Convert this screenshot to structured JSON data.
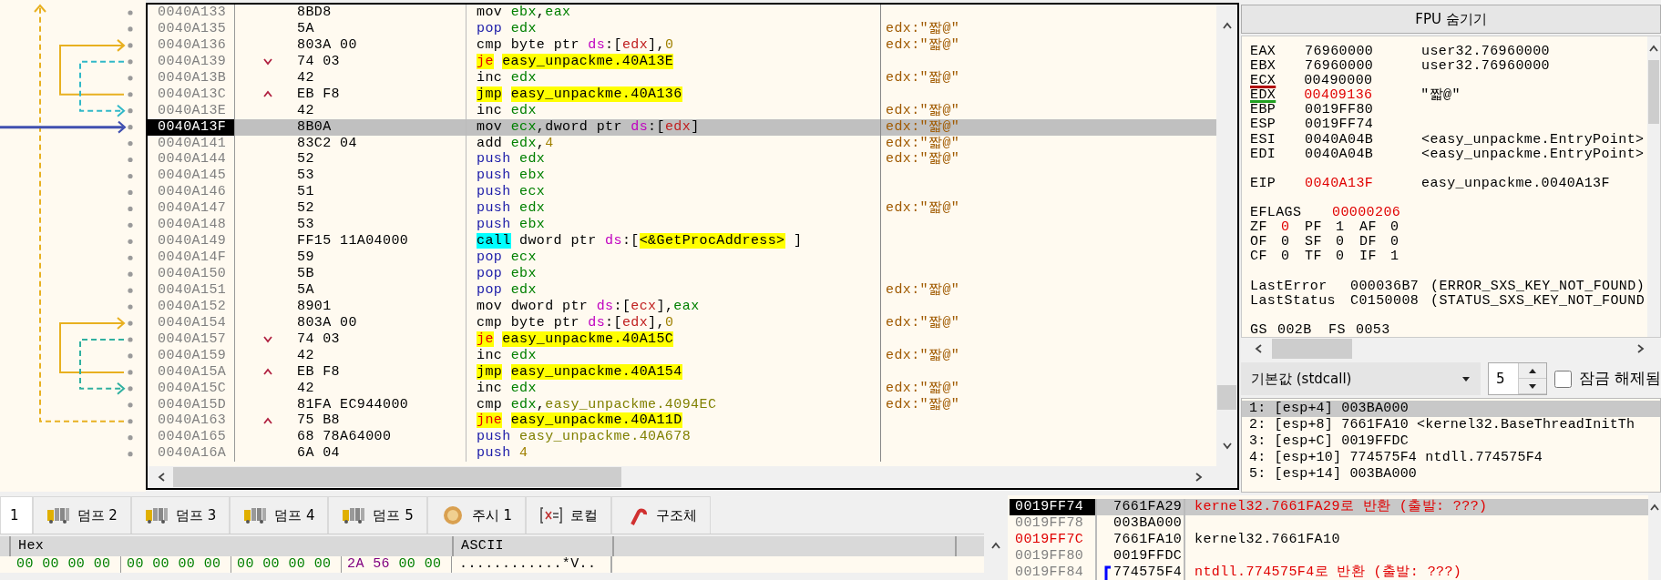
{
  "disassembly": {
    "rows": [
      {
        "address": "0040A133",
        "bytes": "8BD8",
        "instruction": [
          [
            {
              "kind": "op",
              "text": "mov"
            }
          ],
          [
            {
              "kind": "reg",
              "text": "ebx"
            },
            {
              "kind": "plain",
              "text": ","
            },
            {
              "kind": "reg",
              "text": "eax"
            }
          ]
        ],
        "selected": false,
        "current": false
      },
      {
        "address": "0040A135",
        "bytes": "5A",
        "instruction": [
          [
            {
              "kind": "stack",
              "text": "pop"
            }
          ],
          [
            {
              "kind": "reg",
              "text": "edx"
            }
          ]
        ],
        "comment": "edx:\"짧@\"",
        "selected": false,
        "current": false
      },
      {
        "address": "0040A136",
        "bytes": "803A 00",
        "instruction": [
          [
            {
              "kind": "op",
              "text": "cmp"
            }
          ],
          [
            {
              "kind": "plain",
              "text": "byte"
            }
          ],
          [
            {
              "kind": "plain",
              "text": "ptr"
            }
          ],
          [
            {
              "kind": "seg",
              "text": "ds"
            },
            {
              "kind": "plain",
              "text": ":["
            },
            {
              "kind": "memreg",
              "text": "edx"
            },
            {
              "kind": "plain",
              "text": "],"
            },
            {
              "kind": "num",
              "text": "0"
            }
          ]
        ],
        "comment": "edx:\"짧@\"",
        "selected": false,
        "current": false
      },
      {
        "address": "0040A139",
        "kind": "jump-down",
        "bytes": "74 03",
        "instruction": [
          [
            {
              "kind": "jcc",
              "text": "je"
            }
          ],
          [
            {
              "kind": "target",
              "text": "easy_unpackme.40A13E"
            }
          ]
        ],
        "selected": false,
        "current": false
      },
      {
        "address": "0040A13B",
        "bytes": "42",
        "instruction": [
          [
            {
              "kind": "op",
              "text": "inc"
            }
          ],
          [
            {
              "kind": "reg",
              "text": "edx"
            }
          ]
        ],
        "comment": "edx:\"짧@\"",
        "selected": false,
        "current": false
      },
      {
        "address": "0040A13C",
        "kind": "jump-up",
        "bytes": "EB F8",
        "instruction": [
          [
            {
              "kind": "jmp",
              "text": "jmp"
            }
          ],
          [
            {
              "kind": "target",
              "text": "easy_unpackme.40A136"
            }
          ]
        ],
        "selected": false,
        "current": false
      },
      {
        "address": "0040A13E",
        "bytes": "42",
        "instruction": [
          [
            {
              "kind": "op",
              "text": "inc"
            }
          ],
          [
            {
              "kind": "reg",
              "text": "edx"
            }
          ]
        ],
        "comment": "edx:\"짧@\"",
        "selected": false,
        "current": false
      },
      {
        "address": "0040A13F",
        "bytes": "8B0A",
        "instruction": [
          [
            {
              "kind": "op",
              "text": "mov"
            }
          ],
          [
            {
              "kind": "reg",
              "text": "ecx"
            },
            {
              "kind": "plain",
              "text": ",dword"
            }
          ],
          [
            {
              "kind": "plain",
              "text": "ptr"
            }
          ],
          [
            {
              "kind": "seg",
              "text": "ds"
            },
            {
              "kind": "plain",
              "text": ":["
            },
            {
              "kind": "memreg",
              "text": "edx"
            },
            {
              "kind": "plain",
              "text": "]"
            }
          ]
        ],
        "comment": "edx:\"짧@\"",
        "selected": true,
        "current": true
      },
      {
        "address": "0040A141",
        "bytes": "83C2 04",
        "instruction": [
          [
            {
              "kind": "op",
              "text": "add"
            }
          ],
          [
            {
              "kind": "reg",
              "text": "edx"
            },
            {
              "kind": "plain",
              "text": ","
            },
            {
              "kind": "num",
              "text": "4"
            }
          ]
        ],
        "comment": "edx:\"짧@\"",
        "selected": false,
        "current": false
      },
      {
        "address": "0040A144",
        "bytes": "52",
        "instruction": [
          [
            {
              "kind": "stack",
              "text": "push"
            }
          ],
          [
            {
              "kind": "reg",
              "text": "edx"
            }
          ]
        ],
        "comment": "edx:\"짧@\"",
        "selected": false,
        "current": false
      },
      {
        "address": "0040A145",
        "bytes": "53",
        "instruction": [
          [
            {
              "kind": "stack",
              "text": "push"
            }
          ],
          [
            {
              "kind": "reg",
              "text": "ebx"
            }
          ]
        ],
        "selected": false,
        "current": false
      },
      {
        "address": "0040A146",
        "bytes": "51",
        "instruction": [
          [
            {
              "kind": "stack",
              "text": "push"
            }
          ],
          [
            {
              "kind": "reg",
              "text": "ecx"
            }
          ]
        ],
        "selected": false,
        "current": false
      },
      {
        "address": "0040A147",
        "bytes": "52",
        "instruction": [
          [
            {
              "kind": "stack",
              "text": "push"
            }
          ],
          [
            {
              "kind": "reg",
              "text": "edx"
            }
          ]
        ],
        "comment": "edx:\"짧@\"",
        "selected": false,
        "current": false
      },
      {
        "address": "0040A148",
        "bytes": "53",
        "instruction": [
          [
            {
              "kind": "stack",
              "text": "push"
            }
          ],
          [
            {
              "kind": "reg",
              "text": "ebx"
            }
          ]
        ],
        "selected": false,
        "current": false
      },
      {
        "address": "0040A149",
        "bytes": "FF15 11A04000",
        "instruction": [
          [
            {
              "kind": "call",
              "text": "call"
            }
          ],
          [
            {
              "kind": "plain",
              "text": "dword"
            }
          ],
          [
            {
              "kind": "plain",
              "text": "ptr"
            }
          ],
          [
            {
              "kind": "seg",
              "text": "ds"
            },
            {
              "kind": "plain",
              "text": ":["
            },
            {
              "kind": "target",
              "text": "<&GetProcAddress>"
            }
          ],
          [
            {
              "kind": "plain",
              "text": "]"
            }
          ]
        ],
        "selected": false,
        "current": false
      },
      {
        "address": "0040A14F",
        "bytes": "59",
        "instruction": [
          [
            {
              "kind": "stack",
              "text": "pop"
            }
          ],
          [
            {
              "kind": "reg",
              "text": "ecx"
            }
          ]
        ],
        "selected": false,
        "current": false
      },
      {
        "address": "0040A150",
        "bytes": "5B",
        "instruction": [
          [
            {
              "kind": "stack",
              "text": "pop"
            }
          ],
          [
            {
              "kind": "reg",
              "text": "ebx"
            }
          ]
        ],
        "selected": false,
        "current": false
      },
      {
        "address": "0040A151",
        "bytes": "5A",
        "instruction": [
          [
            {
              "kind": "stack",
              "text": "pop"
            }
          ],
          [
            {
              "kind": "reg",
              "text": "edx"
            }
          ]
        ],
        "comment": "edx:\"짧@\"",
        "selected": false,
        "current": false
      },
      {
        "address": "0040A152",
        "bytes": "8901",
        "instruction": [
          [
            {
              "kind": "op",
              "text": "mov"
            }
          ],
          [
            {
              "kind": "plain",
              "text": "dword"
            }
          ],
          [
            {
              "kind": "plain",
              "text": "ptr"
            }
          ],
          [
            {
              "kind": "seg",
              "text": "ds"
            },
            {
              "kind": "plain",
              "text": ":["
            },
            {
              "kind": "memreg",
              "text": "ecx"
            },
            {
              "kind": "plain",
              "text": "],"
            },
            {
              "kind": "reg",
              "text": "eax"
            }
          ]
        ],
        "selected": false,
        "current": false
      },
      {
        "address": "0040A154",
        "bytes": "803A 00",
        "instruction": [
          [
            {
              "kind": "op",
              "text": "cmp"
            }
          ],
          [
            {
              "kind": "plain",
              "text": "byte"
            }
          ],
          [
            {
              "kind": "plain",
              "text": "ptr"
            }
          ],
          [
            {
              "kind": "seg",
              "text": "ds"
            },
            {
              "kind": "plain",
              "text": ":["
            },
            {
              "kind": "memreg",
              "text": "edx"
            },
            {
              "kind": "plain",
              "text": "],"
            },
            {
              "kind": "num",
              "text": "0"
            }
          ]
        ],
        "comment": "edx:\"짧@\"",
        "selected": false,
        "current": false
      },
      {
        "address": "0040A157",
        "kind": "jump-down",
        "bytes": "74 03",
        "instruction": [
          [
            {
              "kind": "jcc",
              "text": "je"
            }
          ],
          [
            {
              "kind": "target",
              "text": "easy_unpackme.40A15C"
            }
          ]
        ],
        "selected": false,
        "current": false
      },
      {
        "address": "0040A159",
        "bytes": "42",
        "instruction": [
          [
            {
              "kind": "op",
              "text": "inc"
            }
          ],
          [
            {
              "kind": "reg",
              "text": "edx"
            }
          ]
        ],
        "comment": "edx:\"짧@\"",
        "selected": false,
        "current": false
      },
      {
        "address": "0040A15A",
        "kind": "jump-up",
        "bytes": "EB F8",
        "instruction": [
          [
            {
              "kind": "jmp",
              "text": "jmp"
            }
          ],
          [
            {
              "kind": "target",
              "text": "easy_unpackme.40A154"
            }
          ]
        ],
        "selected": false,
        "current": false
      },
      {
        "address": "0040A15C",
        "bytes": "42",
        "instruction": [
          [
            {
              "kind": "op",
              "text": "inc"
            }
          ],
          [
            {
              "kind": "reg",
              "text": "edx"
            }
          ]
        ],
        "comment": "edx:\"짧@\"",
        "selected": false,
        "current": false
      },
      {
        "address": "0040A15D",
        "bytes": "81FA EC944000",
        "instruction": [
          [
            {
              "kind": "op",
              "text": "cmp"
            }
          ],
          [
            {
              "kind": "reg",
              "text": "edx"
            },
            {
              "kind": "plain",
              "text": ","
            },
            {
              "kind": "sym",
              "text": "easy_unpackme.4094EC"
            }
          ]
        ],
        "comment": "edx:\"짧@\"",
        "selected": false,
        "current": false
      },
      {
        "address": "0040A163",
        "kind": "jump-up",
        "bytes": "75 B8",
        "instruction": [
          [
            {
              "kind": "jcc",
              "text": "jne"
            }
          ],
          [
            {
              "kind": "target",
              "text": "easy_unpackme.40A11D"
            }
          ]
        ],
        "selected": false,
        "current": false
      },
      {
        "address": "0040A165",
        "bytes": "68 78A64000",
        "instruction": [
          [
            {
              "kind": "stack",
              "text": "push"
            }
          ],
          [
            {
              "kind": "sym",
              "text": "easy_unpackme.40A678"
            }
          ]
        ],
        "selected": false,
        "current": false
      },
      {
        "address": "0040A16A",
        "bytes": "6A 04",
        "instruction": [
          [
            {
              "kind": "stack",
              "text": "push"
            }
          ],
          [
            {
              "kind": "num",
              "text": "4"
            }
          ]
        ],
        "selected": false,
        "current": false
      }
    ]
  },
  "registers_panel": {
    "fpu_button": "FPU 숨기기",
    "registers": [
      {
        "name": "EAX",
        "value": "76960000",
        "comment": "user32.76960000",
        "changed": false
      },
      {
        "name": "EBX",
        "value": "76960000",
        "comment": "user32.76960000",
        "changed": false
      },
      {
        "name": "ECX",
        "value": "00490000",
        "changed": false,
        "color": "#b00000"
      },
      {
        "name": "EDX",
        "value": "00409136",
        "comment": "\"짧@\"",
        "changed": true,
        "color": "#20a020"
      },
      {
        "name": "EBP",
        "value": "0019FF80",
        "changed": false
      },
      {
        "name": "ESP",
        "value": "0019FF74",
        "changed": false
      },
      {
        "name": "ESI",
        "value": "0040A04B",
        "comment": "<easy_unpackme.EntryPoint>",
        "changed": false
      },
      {
        "name": "EDI",
        "value": "0040A04B",
        "comment": "<easy_unpackme.EntryPoint>",
        "changed": false
      }
    ],
    "eip": {
      "name": "EIP",
      "value": "0040A13F",
      "comment": "easy_unpackme.0040A13F",
      "changed": true
    },
    "eflags": {
      "name": "EFLAGS",
      "value": "00000206",
      "changed": true
    },
    "flags": [
      {
        "name": "ZF",
        "value": "0",
        "changed": true
      },
      {
        "name": "PF",
        "value": "1",
        "changed": false
      },
      {
        "name": "AF",
        "value": "0",
        "changed": false
      },
      {
        "name": "OF",
        "value": "0",
        "changed": false
      },
      {
        "name": "SF",
        "value": "0",
        "changed": false
      },
      {
        "name": "DF",
        "value": "0",
        "changed": false
      },
      {
        "name": "CF",
        "value": "0",
        "changed": false
      },
      {
        "name": "TF",
        "value": "0",
        "changed": false
      },
      {
        "name": "IF",
        "value": "1",
        "changed": false
      }
    ],
    "status": [
      {
        "name": "LastError",
        "value": "000036B7",
        "text": "(ERROR_SXS_KEY_NOT_FOUND)"
      },
      {
        "name": "LastStatus",
        "value": "C0150008",
        "text": "(STATUS_SXS_KEY_NOT_FOUND"
      }
    ],
    "segments": [
      {
        "name": "GS",
        "value": "002B"
      },
      {
        "name": "FS",
        "value": "0053"
      }
    ]
  },
  "call_convention": {
    "value": "기본값 (stdcall)",
    "arg_count": "5",
    "lock_label": "잠금 해제됨",
    "locked": false
  },
  "arguments": [
    {
      "text": "1: [esp+4] 003BA000",
      "selected": true
    },
    {
      "text": "2: [esp+8] 7661FA10 <kernel32.BaseThreadInitTh",
      "selected": false
    },
    {
      "text": "3: [esp+C] 0019FFDC",
      "selected": false
    },
    {
      "text": "4: [esp+10] 774575F4 ntdll.774575F4",
      "selected": false
    },
    {
      "text": "5: [esp+14] 003BA000",
      "selected": false
    }
  ],
  "dump_tabs": [
    {
      "label": "1",
      "selected": true
    },
    {
      "label": "덤프 2",
      "kind": "dump",
      "selected": false
    },
    {
      "label": "덤프 3",
      "kind": "dump",
      "selected": false
    },
    {
      "label": "덤프 4",
      "kind": "dump",
      "selected": false
    },
    {
      "label": "덤프 5",
      "kind": "dump",
      "selected": false
    },
    {
      "label": "주시 1",
      "kind": "watch",
      "selected": false
    },
    {
      "label": "로컬",
      "kind": "locals",
      "selected": false
    },
    {
      "label": "구조체",
      "kind": "struct",
      "selected": false
    }
  ],
  "dump": {
    "columns": [
      "Hex",
      "ASCII"
    ],
    "rows": [
      {
        "hex_groups": [
          [
            {
              "text": "00",
              "kind": "zero"
            },
            {
              "text": "00",
              "kind": "zero"
            },
            {
              "text": "00",
              "kind": "zero"
            },
            {
              "text": "00",
              "kind": "zero"
            }
          ],
          [
            {
              "text": "00",
              "kind": "zero"
            },
            {
              "text": "00",
              "kind": "zero"
            },
            {
              "text": "00",
              "kind": "zero"
            },
            {
              "text": "00",
              "kind": "zero"
            }
          ],
          [
            {
              "text": "00",
              "kind": "zero"
            },
            {
              "text": "00",
              "kind": "zero"
            },
            {
              "text": "00",
              "kind": "zero"
            },
            {
              "text": "00",
              "kind": "zero"
            }
          ],
          [
            {
              "text": "2A",
              "kind": "data"
            },
            {
              "text": "56",
              "kind": "data"
            },
            {
              "text": "00",
              "kind": "zero"
            },
            {
              "text": "00",
              "kind": "zero"
            }
          ]
        ],
        "ascii": "............*V.."
      }
    ]
  },
  "stack": {
    "rows": [
      {
        "address": "0019FF74",
        "value": "7661FA29",
        "comment": "kernel32.7661FA29로 반환 (출발: ???)",
        "kind": "return",
        "selected": true,
        "current": true,
        "changed": false,
        "frame": false
      },
      {
        "address": "0019FF78",
        "value": "003BA000",
        "selected": false,
        "current": false,
        "changed": false,
        "frame": false
      },
      {
        "address": "0019FF7C",
        "value": "7661FA10",
        "comment": "kernel32.7661FA10",
        "kind": "plain",
        "selected": false,
        "current": false,
        "changed": true,
        "frame": false
      },
      {
        "address": "0019FF80",
        "value": "0019FFDC",
        "selected": false,
        "current": false,
        "changed": false,
        "frame": false
      },
      {
        "address": "0019FF84",
        "value": "774575F4",
        "comment": "ntdll.774575F4로 반환 (출발: ???)",
        "kind": "return",
        "selected": false,
        "current": false,
        "changed": false,
        "frame": true
      }
    ]
  }
}
